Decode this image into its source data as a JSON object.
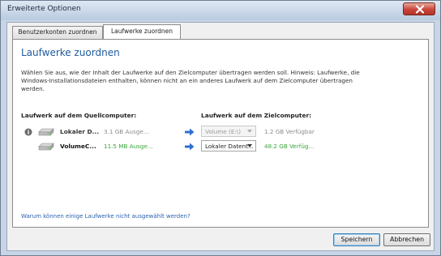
{
  "window": {
    "title": "Erweiterte Optionen",
    "close_icon": "close-icon"
  },
  "tabs": [
    {
      "label": "Benutzerkonten zuordnen",
      "active": false
    },
    {
      "label": "Laufwerke zuordnen",
      "active": true
    }
  ],
  "panel": {
    "heading": "Laufwerke zuordnen",
    "description": "Wählen Sie aus, wie der Inhalt der Laufwerke auf den Zielcomputer übertragen werden soll. Hinweis: Laufwerke, die Windows-Installationsdateien enthalten, können nicht an ein anderes Laufwerk auf dem Zielcomputer übertragen werden.",
    "source_header": "Laufwerk auf dem Quellcomputer:",
    "target_header": "Laufwerk auf dem Zielcomputer:",
    "rows": [
      {
        "source_name": "Lokaler D...",
        "source_size": "3.1 GB Ausge...",
        "target_value": "Volume (E:\\)",
        "target_enabled": false,
        "target_free": "1.2 GB Verfügbar",
        "status_color": "#8a8a8a",
        "has_info_icon": true
      },
      {
        "source_name": "VolumeC...",
        "source_size": "11.5 MB Ausge...",
        "target_value": "Lokaler Datent...",
        "target_enabled": true,
        "target_free": "48.2 GB Verfüg...",
        "status_color": "#3aa53a",
        "has_info_icon": false
      }
    ],
    "help_link": "Warum können einige Laufwerke nicht ausgewählt werden?"
  },
  "buttons": {
    "save": "Speichern",
    "cancel": "Abbrechen"
  },
  "colors": {
    "accent": "#1e5a9c",
    "link": "#2a62b0",
    "arrow": "#2f6fd1",
    "green": "#3aa53a"
  }
}
